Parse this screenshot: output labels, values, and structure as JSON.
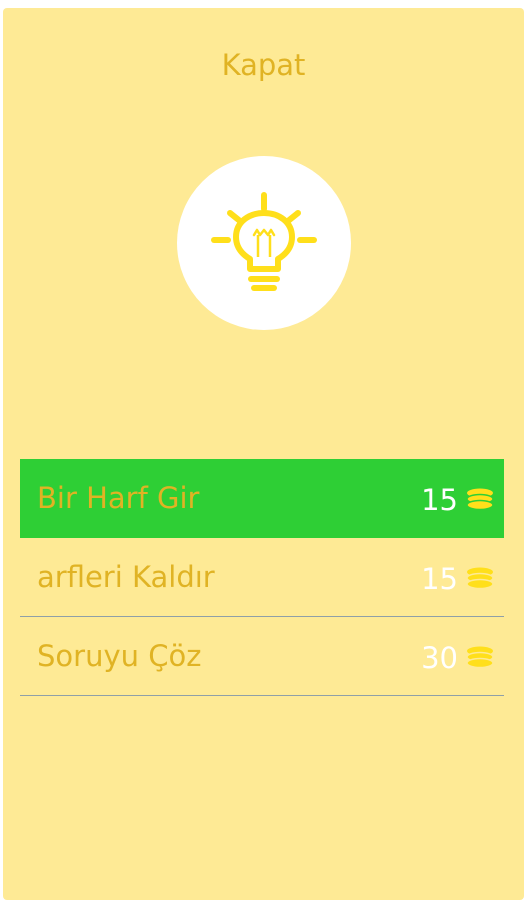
{
  "header": {
    "close_label": "Kapat"
  },
  "hint": {
    "icon": "lightbulb-icon",
    "icon_color": "#ffdf1b"
  },
  "menu": {
    "items": [
      {
        "label": "Bir Harf Gir",
        "price": "15",
        "icon": "coin-stack-icon",
        "active": true
      },
      {
        "label": "arfleri Kaldır",
        "price": "15",
        "icon": "coin-stack-icon",
        "active": false
      },
      {
        "label": "Soruyu Çöz",
        "price": "30",
        "icon": "coin-stack-icon",
        "active": false
      }
    ]
  },
  "colors": {
    "background": "#feea95",
    "accent_text": "#e0b324",
    "active_row": "#2ecf35",
    "coin": "#ffdf1b"
  }
}
